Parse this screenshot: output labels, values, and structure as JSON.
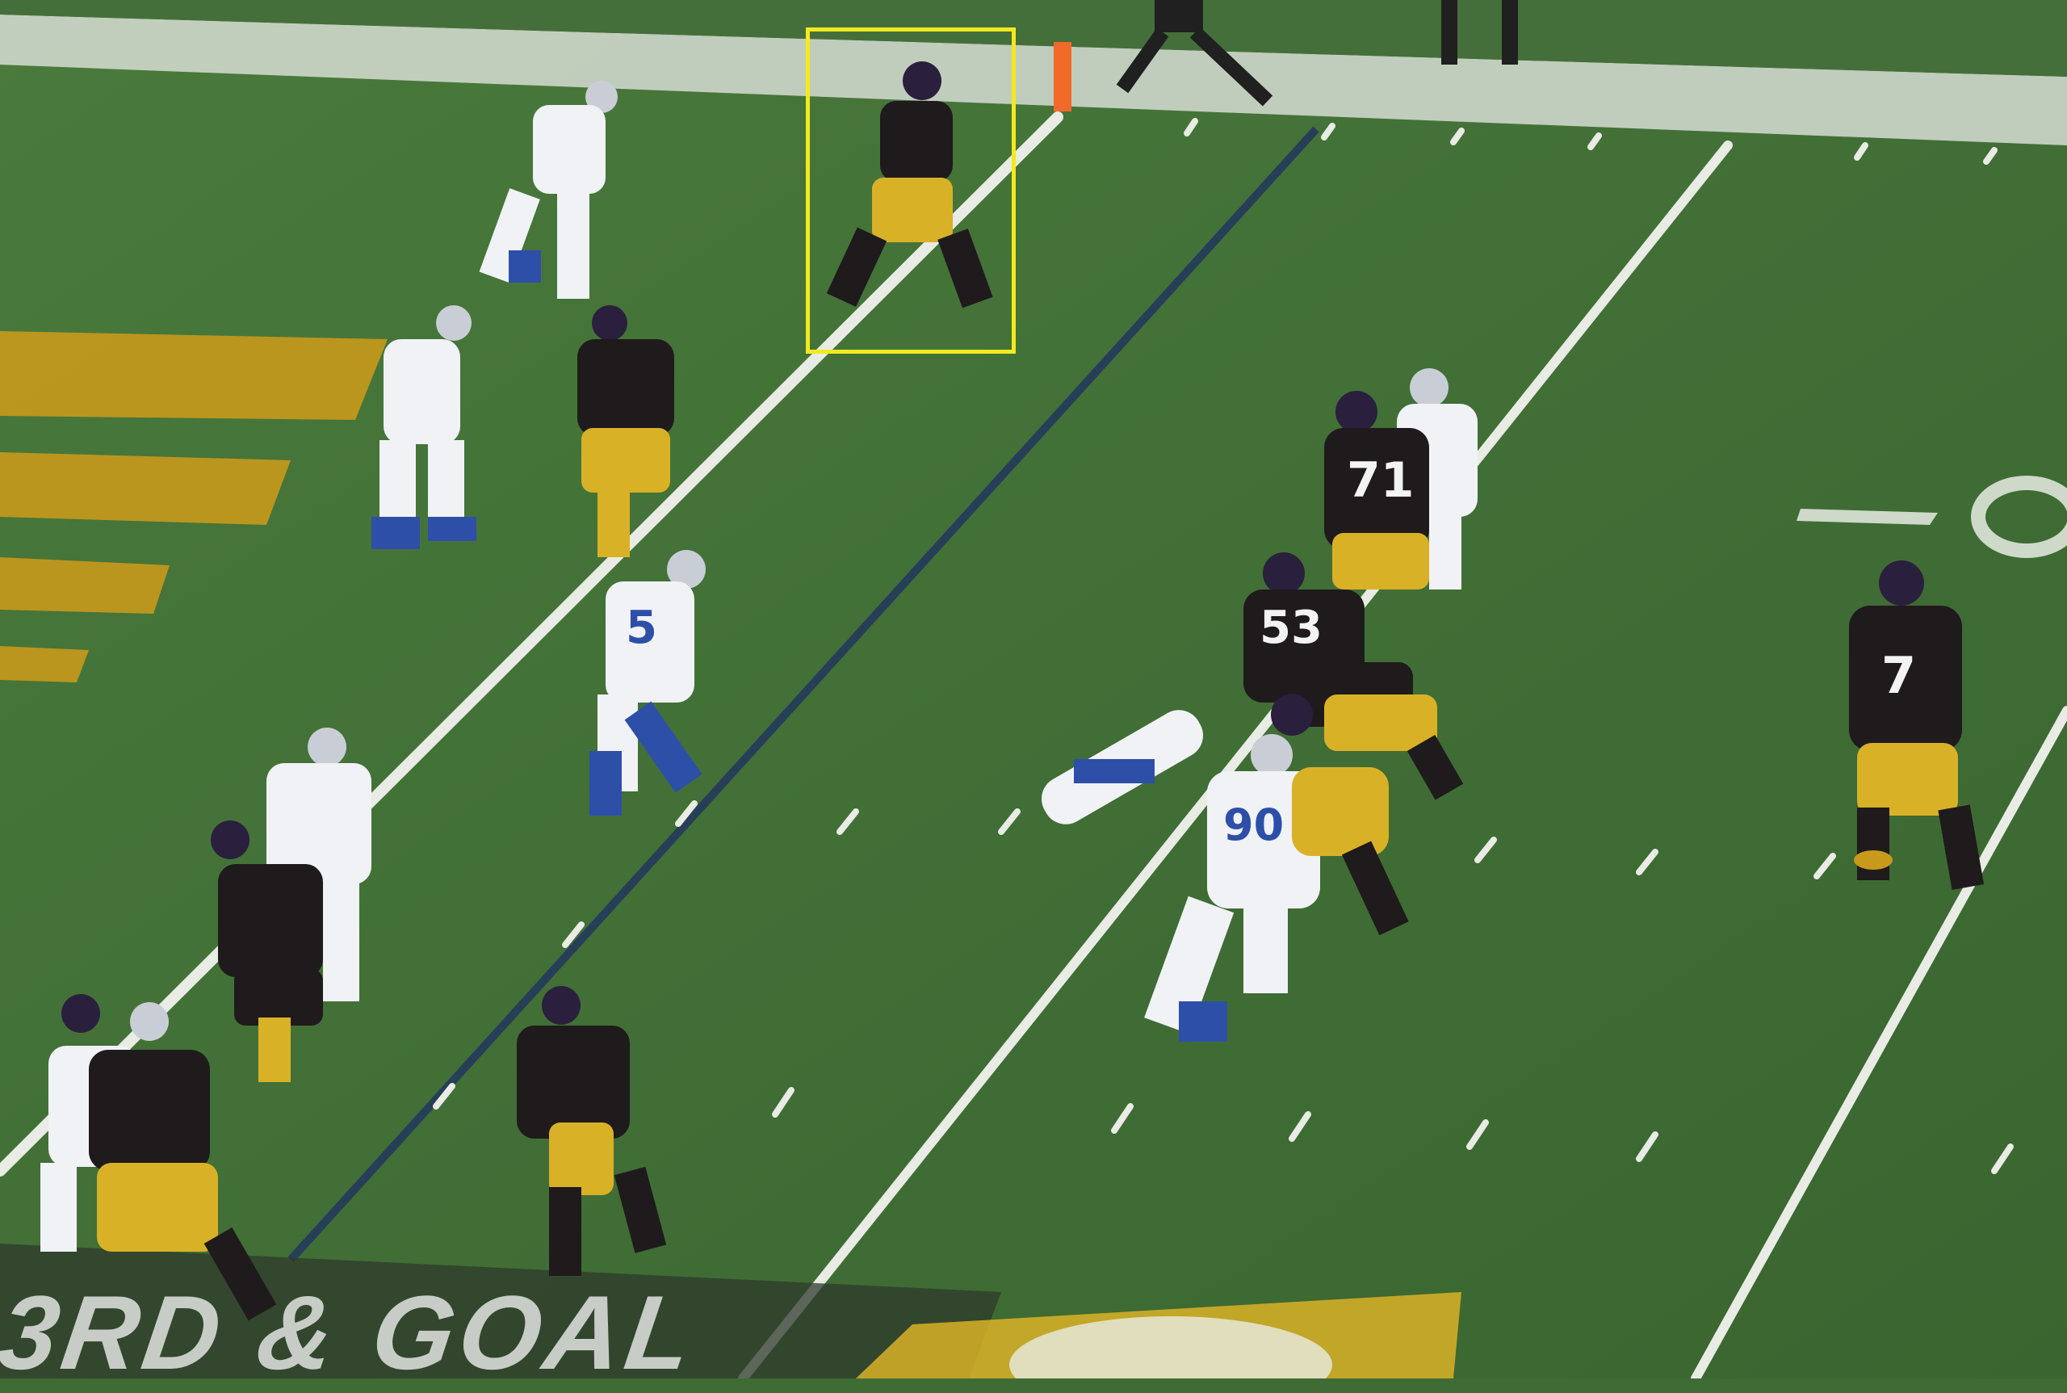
{
  "scene": {
    "overlay": {
      "down_and_distance": "3RD & GOAL"
    },
    "highlight": {
      "label": ""
    },
    "jersey_numbers": [
      {
        "id": "steelers-71",
        "text": "71"
      },
      {
        "id": "steelers-53",
        "text": "53"
      },
      {
        "id": "steelers-7",
        "text": "7"
      },
      {
        "id": "cowboys-90",
        "text": "90"
      },
      {
        "id": "cowboys-5",
        "text": "5"
      }
    ],
    "colors": {
      "turf": "#3f6b34",
      "turf_light": "#4d7c3f",
      "yard_line": "#e8ece4",
      "highlight_box": "#f2ea1f",
      "steelers_gold": "#d9b127",
      "steelers_black": "#1f1a1c",
      "cowboys_white": "#f0f2f5",
      "cowboys_blue": "#2d4fa8",
      "end_zone_gold": "#c79a1c"
    }
  }
}
